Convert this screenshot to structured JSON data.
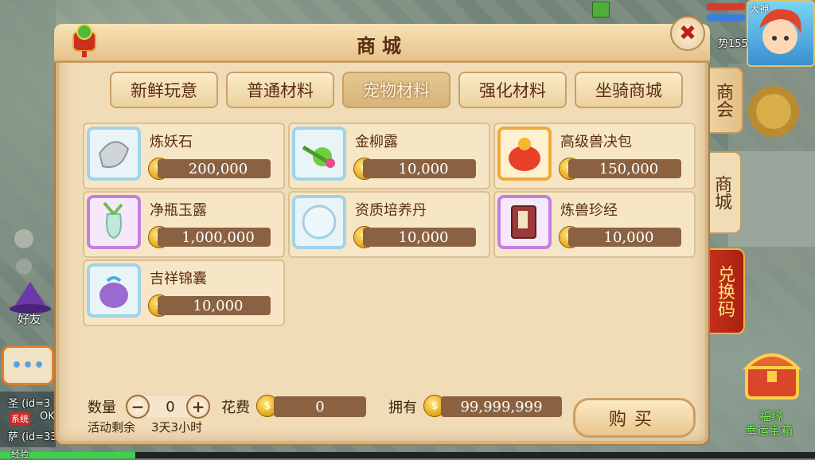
{
  "hud": {
    "top_right_avatar_badge": "大神",
    "level_text": "势155",
    "left_friend_label": "好友",
    "chat_lines": [
      "圣 (id=3",
      "OK.",
      "萨 (id=33"
    ],
    "chat_badge": "系统",
    "exp_label": "经验",
    "treasure_label_1": "福缘",
    "treasure_label_2": "幸运宝箱"
  },
  "panel": {
    "title": "商城",
    "close_symbol": "✖"
  },
  "tabs": [
    {
      "label": "新鲜玩意",
      "active": false
    },
    {
      "label": "普通材料",
      "active": false
    },
    {
      "label": "宠物材料",
      "active": true
    },
    {
      "label": "强化材料",
      "active": false
    },
    {
      "label": "坐骑商城",
      "active": false
    }
  ],
  "items": [
    {
      "name": "炼妖石",
      "price": "200,000",
      "icon": "silver-stone-icon",
      "frame": "blue"
    },
    {
      "name": "金柳露",
      "price": "10,000",
      "icon": "green-fruit-icon",
      "frame": "blue"
    },
    {
      "name": "高级兽决包",
      "price": "150,000",
      "icon": "lucky-bag-icon",
      "frame": "orange"
    },
    {
      "name": "净瓶玉露",
      "price": "1,000,000",
      "icon": "jade-vase-icon",
      "frame": "purple"
    },
    {
      "name": "资质培养丹",
      "price": "10,000",
      "icon": "snow-pearl-icon",
      "frame": "blue"
    },
    {
      "name": "炼兽珍经",
      "price": "10,000",
      "icon": "scripture-book-icon",
      "frame": "purple"
    },
    {
      "name": "吉祥锦囊",
      "price": "10,000",
      "icon": "pouch-icon",
      "frame": "blue"
    }
  ],
  "bottom": {
    "quantity_label": "数量",
    "quantity_value": "0",
    "minus": "−",
    "plus": "+",
    "cost_label": "花费",
    "cost_value": "0",
    "own_label": "拥有",
    "own_value": "99,999,999",
    "remaining_label": "活动剩余",
    "remaining_value": "3天3小时",
    "buy_label": "购买"
  },
  "side_tabs": [
    {
      "label": "商会",
      "active": false
    },
    {
      "label": "商城",
      "active": true
    },
    {
      "label": "兑换码",
      "active": false
    }
  ],
  "colors": {
    "panel_bg": "#f0dcb6",
    "price_bar": "#8a6242",
    "title_text": "#5a2e12",
    "close_red": "#c02018",
    "redeem_tab": "#c9301e"
  }
}
